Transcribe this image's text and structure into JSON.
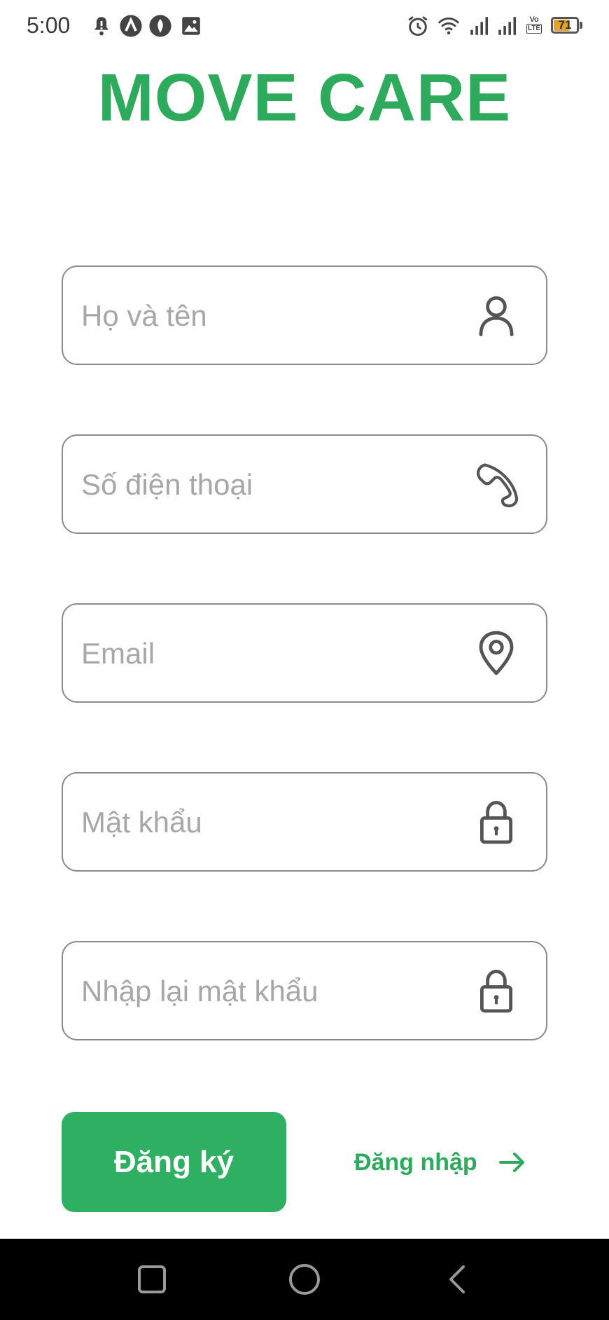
{
  "status_bar": {
    "time": "5:00",
    "network_label": "Vo",
    "lte_label": "LTE",
    "battery": "71",
    "battery_level": 0.71,
    "icons": [
      "notification-bell-icon",
      "app-icon",
      "app-icon",
      "image-icon",
      "alarm-icon",
      "wifi-icon",
      "signal-icon",
      "signal-icon"
    ]
  },
  "app": {
    "title": "MOVE CARE",
    "brand_color": "#2eaa5c"
  },
  "form": {
    "fields": [
      {
        "placeholder": "Họ và tên",
        "value": "",
        "icon": "person-icon"
      },
      {
        "placeholder": "Số điện thoại",
        "value": "",
        "icon": "phone-icon"
      },
      {
        "placeholder": "Email",
        "value": "",
        "icon": "location-pin-icon"
      },
      {
        "placeholder": "Mật khẩu",
        "value": "",
        "icon": "lock-icon"
      },
      {
        "placeholder": "Nhập lại mật khẩu",
        "value": "",
        "icon": "lock-icon"
      }
    ],
    "register_label": "Đăng ký",
    "login_label": "Đăng nhập",
    "login_icon": "arrow-right-icon"
  },
  "nav_bar": {
    "icons": [
      "recent-apps-icon",
      "home-icon",
      "back-icon"
    ]
  }
}
